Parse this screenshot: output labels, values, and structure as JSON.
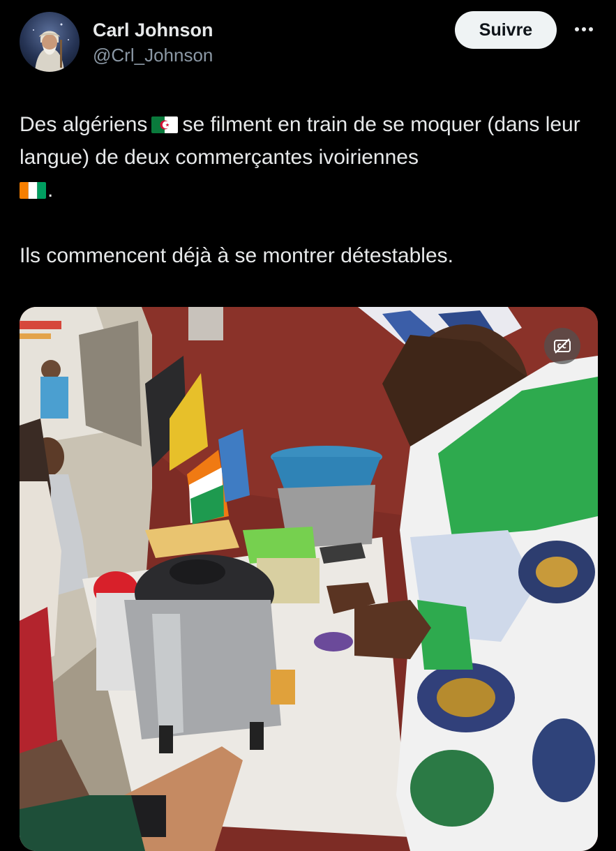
{
  "author": {
    "display_name": "Carl Johnson",
    "handle": "@Crl_Johnson",
    "avatar_icon": "avatar-wizard-icon"
  },
  "actions": {
    "follow_label": "Suivre",
    "more_icon": "more-horizontal-icon"
  },
  "tweet": {
    "line1_part1": "Des algériens",
    "line1_part2": "se filment en train de se moquer (dans leur langue) de deux commerçantes ivoiriennes",
    "line1_end": ".",
    "line2": "Ils commencent déjà à se montrer détestables.",
    "flag_1": "algeria-flag-icon",
    "flag_2": "cote-divoire-flag-icon"
  },
  "media": {
    "type": "video",
    "caption_toggle_icon": "closed-captions-off-icon"
  },
  "colors": {
    "background": "#000000",
    "text": "#e7e9ea",
    "secondary_text": "#8b98a5",
    "follow_button_bg": "#eff3f4",
    "follow_button_text": "#0f1419"
  }
}
